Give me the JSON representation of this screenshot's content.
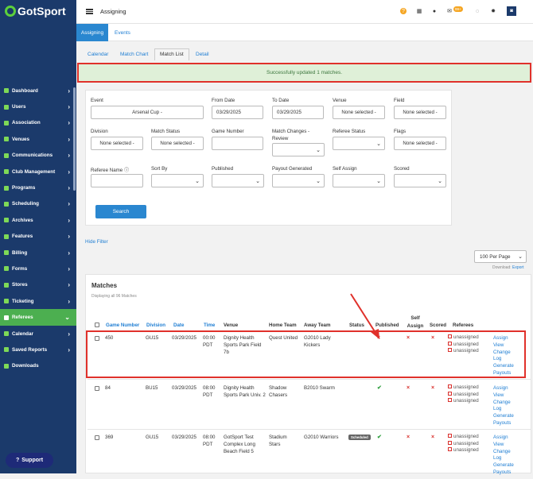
{
  "brand": {
    "logo_text": "GotSport"
  },
  "sidebar": {
    "items": [
      {
        "label": "Dashboard",
        "icon": "dashboard-icon"
      },
      {
        "label": "Users",
        "icon": "users-icon"
      },
      {
        "label": "Association",
        "icon": "association-icon"
      },
      {
        "label": "Venues",
        "icon": "venues-icon"
      },
      {
        "label": "Communications",
        "icon": "communications-icon"
      },
      {
        "label": "Club Management",
        "icon": "club-icon"
      },
      {
        "label": "Programs",
        "icon": "programs-icon"
      },
      {
        "label": "Scheduling",
        "icon": "scheduling-icon"
      },
      {
        "label": "Archives",
        "icon": "archives-icon"
      },
      {
        "label": "Features",
        "icon": "features-icon"
      },
      {
        "label": "Billing",
        "icon": "billing-icon"
      },
      {
        "label": "Forms",
        "icon": "forms-icon"
      },
      {
        "label": "Stores",
        "icon": "stores-icon"
      },
      {
        "label": "Ticketing",
        "icon": "ticketing-icon"
      },
      {
        "label": "Referees",
        "icon": "referees-icon",
        "active": true
      },
      {
        "label": "Calendar",
        "icon": "calendar-icon"
      },
      {
        "label": "Saved Reports",
        "icon": "reports-icon"
      },
      {
        "label": "Downloads",
        "icon": "downloads-icon"
      }
    ],
    "support_label": "Support"
  },
  "topbar": {
    "title": "Assigning",
    "notification_count": "99+"
  },
  "tabs": {
    "assigning": "Assigning",
    "events": "Events"
  },
  "subtabs": {
    "calendar": "Calendar",
    "match_chart": "Match Chart",
    "match_list": "Match List",
    "detail": "Detail"
  },
  "alert": {
    "message": "Successfully updated 1 matches."
  },
  "filters": {
    "event_label": "Event",
    "event_value": "Arsenal Cup -",
    "from_date_label": "From Date",
    "from_date_value": "03/29/2025",
    "to_date_label": "To Date",
    "to_date_value": "03/29/2025",
    "venue_label": "Venue",
    "venue_value": "None selected -",
    "field_label": "Field",
    "field_value": "None selected -",
    "division_label": "Division",
    "division_value": "None selected -",
    "match_status_label": "Match Status",
    "match_status_value": "None selected -",
    "game_number_label": "Game Number",
    "match_changes_label": "Match Changes - Review",
    "referee_status_label": "Referee Status",
    "flags_label": "Flags",
    "flags_value": "None selected -",
    "referee_name_label": "Referee Name",
    "sort_by_label": "Sort By",
    "published_label": "Published",
    "payout_generated_label": "Payout Generated",
    "self_assign_label": "Self Assign",
    "scored_label": "Scored",
    "search_label": "Search"
  },
  "hide_filter_label": "Hide Filter",
  "per_page": "100 Per Page",
  "download": {
    "label": "Download:",
    "link": "Export"
  },
  "matches": {
    "title": "Matches",
    "displaying": "Displaying all 96 Matches",
    "columns": {
      "game_number": "Game Number",
      "division": "Division",
      "date": "Date",
      "time": "Time",
      "venue": "Venue",
      "home_team": "Home Team",
      "away_team": "Away Team",
      "status": "Status",
      "published": "Published",
      "self_assign": "Self Assign",
      "scored": "Scored",
      "referees": "Referees"
    },
    "rows": [
      {
        "game": "450",
        "division": "GU15",
        "date": "03/29/2025",
        "time": "00:00 PDT",
        "venue": "Dignity Health Sports Park Field 7b",
        "home": "Quest United",
        "away": "G2010 Lady Kickers",
        "status": "",
        "published": "x"
      },
      {
        "game": "84",
        "division": "BU15",
        "date": "03/29/2025",
        "time": "08:00 PDT",
        "venue": "Dignity Health Sports Park Univ. 2",
        "home": "Shadow Chasers",
        "away": "B2010 Swarm",
        "status": "",
        "published": "check"
      },
      {
        "game": "369",
        "division": "GU15",
        "date": "03/29/2025",
        "time": "08:00 PDT",
        "venue": "GotSport Test Complex Long Beach Field 5",
        "home": "Stadium Stars",
        "away": "G2010 Warriors",
        "status": "Scheduled",
        "published": "check"
      }
    ],
    "referee_unassigned": "unassigned",
    "actions": {
      "assign": "Assign",
      "view": "View",
      "change_log": "Change Log",
      "generate_payouts": "Generate Payouts"
    }
  },
  "colors": {
    "sidebar_bg": "#1b3a6b",
    "accent": "#2a87d0",
    "active_nav": "#4caf50",
    "highlight": "#e0312b",
    "success_bg": "#dff0d8"
  }
}
